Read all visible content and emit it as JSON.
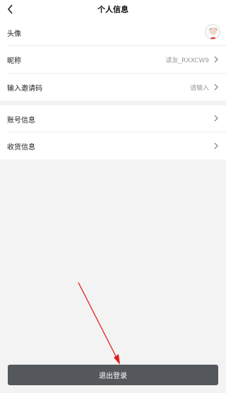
{
  "header": {
    "title": "个人信息"
  },
  "profile": {
    "avatar_label": "头像",
    "nickname_label": "昵称",
    "nickname_value": "读友_RXXCW9",
    "invite_label": "输入邀请码",
    "invite_placeholder": "请输入"
  },
  "account": {
    "account_label": "账号信息",
    "shipping_label": "收货信息"
  },
  "footer": {
    "logout_label": "退出登录"
  },
  "colors": {
    "button_bg": "#54585c",
    "annotation": "#e02020"
  }
}
